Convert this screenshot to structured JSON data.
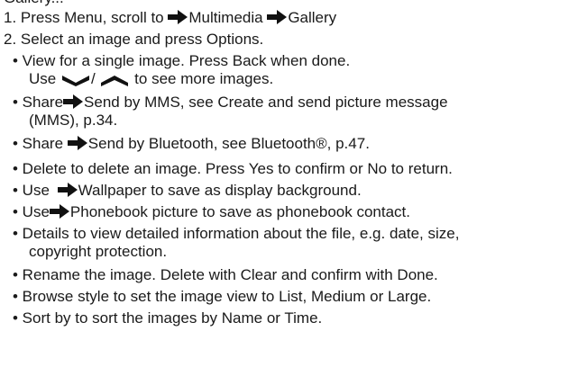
{
  "document": {
    "cutoff_line": "Gallery...",
    "steps": [
      {
        "number": "1.",
        "text_a": "Press Menu, scroll to",
        "text_b": "Multimedia",
        "text_c": "Gallery"
      },
      {
        "number": "2.",
        "text": "Select an image and press Options."
      }
    ],
    "bullets": {
      "view_a": "• View  for a single image. Press Back when done.",
      "view_b_pre": "Use",
      "view_b_sep": "/",
      "view_b_post": "to see more images.",
      "share_mms_a": "• Share",
      "share_mms_b": "Send by MMS, see Create and send picture message",
      "share_mms_c": "(MMS), p.34.",
      "share_bt_a": "• Share",
      "share_bt_b": "Send by Bluetooth, see Bluetooth®, p.47.",
      "delete": "• Delete to delete an image. Press Yes to confirm or No to return.",
      "wallpaper_a": "• Use",
      "wallpaper_b": "Wallpaper to save as display background.",
      "phonebook_a": "• Use",
      "phonebook_b": "Phonebook picture to save as phonebook contact.",
      "details_a": "• Details to view detailed information about the file, e.g. date, size,",
      "details_b": "copyright protection.",
      "rename": "• Rename the image. Delete with Clear and confirm with Done.",
      "browse": "• Browse style to set the image view to List, Medium or Large.",
      "sort": "• Sort by to sort the images by Name or Time."
    }
  },
  "icons": {
    "arrow": "right-arrow-icon",
    "down": "chevron-down-icon",
    "up": "chevron-up-icon"
  }
}
